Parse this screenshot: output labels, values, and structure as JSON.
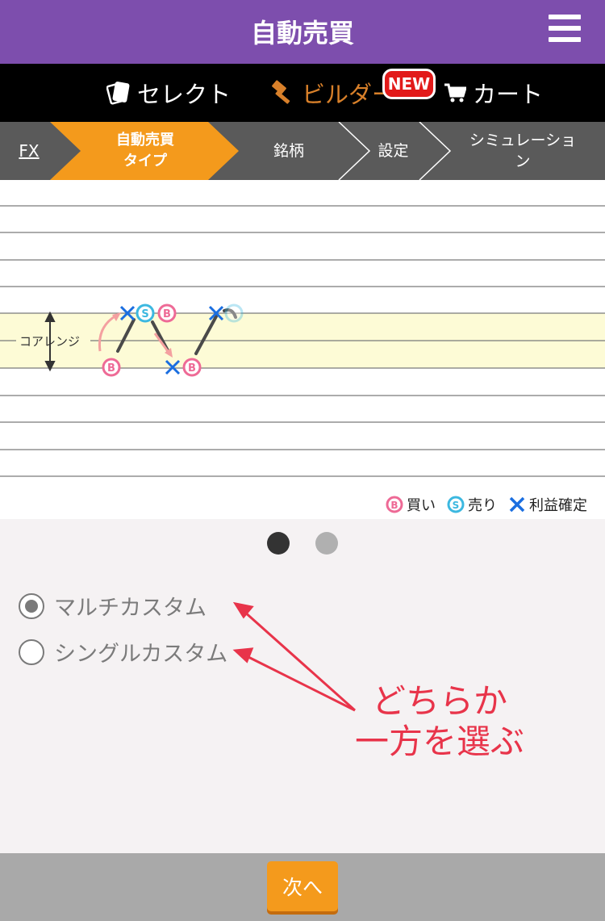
{
  "header": {
    "title": "自動売買",
    "menu_icon": "hamburger-menu-icon"
  },
  "modebar": {
    "select_label": "セレクト",
    "builder_label": "ビルダー",
    "new_badge": "NEW",
    "cart_label": "カート",
    "active_color": "#d8802a"
  },
  "steps": {
    "fx": "FX",
    "type_line1": "自動売買",
    "type_line2": "タイプ",
    "symbol": "銘柄",
    "settings": "設定",
    "sim_line1": "シミュレーショ",
    "sim_line2": "ン",
    "active_color": "#f49a1c"
  },
  "chart": {
    "core_range_label": "コアレンジ",
    "legend": {
      "buy_badge": "B",
      "buy": "買い",
      "sell_badge": "S",
      "sell": "売り",
      "profit": "利益確定"
    },
    "band_color": "#fdfbd6",
    "buy_color": "#ee6a96",
    "sell_color": "#3cb8e0",
    "profit_color": "#1a6ee0"
  },
  "pager": {
    "total": 2,
    "current": 1
  },
  "options": [
    {
      "label": "マルチカスタム",
      "selected": true
    },
    {
      "label": "シングルカスタム",
      "selected": false
    }
  ],
  "annotation": {
    "line1": "どちらか",
    "line2": "一方を選ぶ",
    "color": "#e8344a"
  },
  "footer": {
    "next_label": "次へ"
  }
}
